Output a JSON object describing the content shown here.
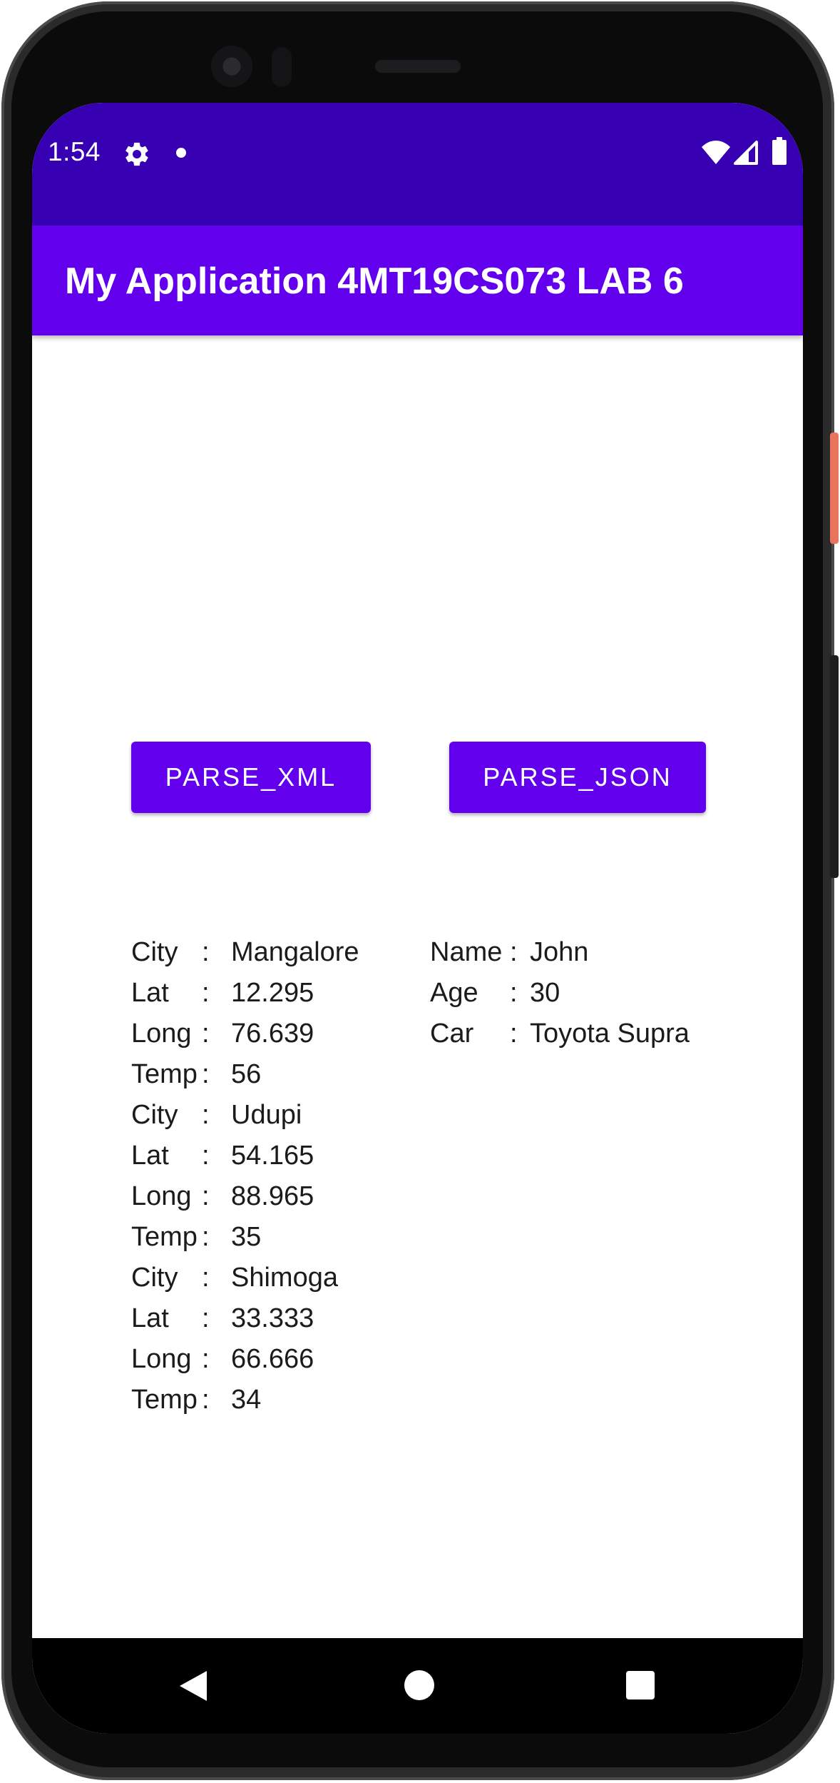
{
  "status_bar": {
    "time": "1:54",
    "icons": [
      "gear-icon",
      "notification-dot-icon",
      "wifi-icon",
      "signal-icon",
      "battery-icon"
    ]
  },
  "app_bar": {
    "title": "My Application 4MT19CS073 LAB 6"
  },
  "buttons": {
    "parse_xml": "PARSE_XML",
    "parse_json": "PARSE_JSON"
  },
  "xml_output": [
    {
      "key": "City",
      "value": "Mangalore"
    },
    {
      "key": "Lat",
      "value": "12.295"
    },
    {
      "key": "Long",
      "value": "76.639"
    },
    {
      "key": "Temp",
      "value": "56"
    },
    {
      "key": "City",
      "value": "Udupi"
    },
    {
      "key": "Lat",
      "value": "54.165"
    },
    {
      "key": "Long",
      "value": "88.965"
    },
    {
      "key": "Temp",
      "value": "35"
    },
    {
      "key": "City",
      "value": "Shimoga"
    },
    {
      "key": "Lat",
      "value": "33.333"
    },
    {
      "key": "Long",
      "value": "66.666"
    },
    {
      "key": "Temp",
      "value": "34"
    }
  ],
  "json_output": [
    {
      "key": "Name",
      "value": "John"
    },
    {
      "key": "Age",
      "value": "30"
    },
    {
      "key": "Car",
      "value": "Toyota Supra"
    }
  ],
  "separator": ":",
  "nav_bar": {
    "icons": [
      "back-icon",
      "home-icon",
      "recents-icon"
    ]
  },
  "colors": {
    "status_bar": "#3700b3",
    "app_bar": "#6200ee",
    "button": "#6200ee"
  }
}
